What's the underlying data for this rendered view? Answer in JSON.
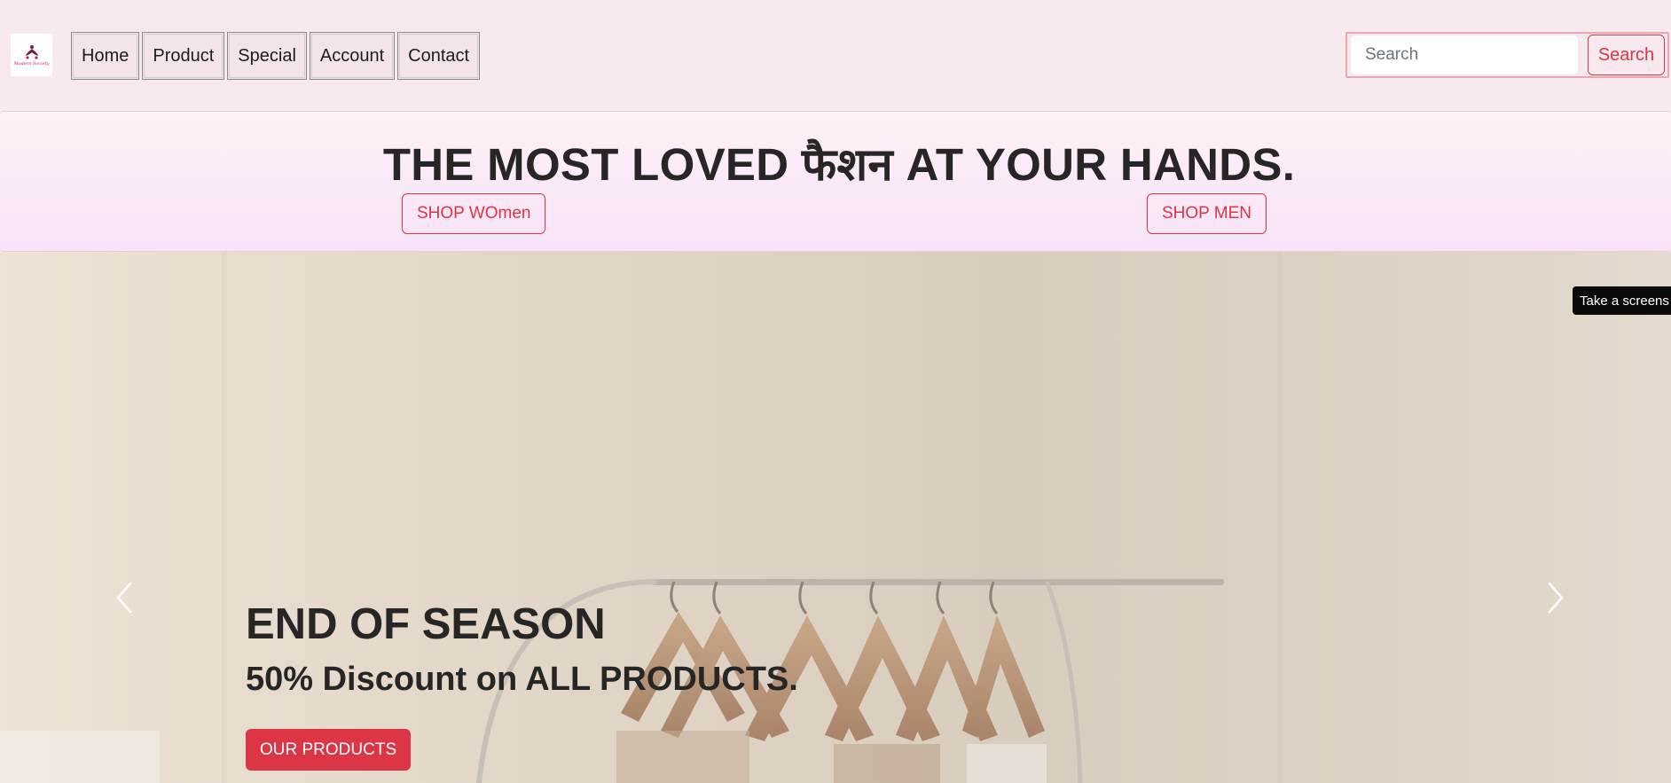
{
  "navbar": {
    "logo_text": "Modern Society",
    "links": [
      "Home",
      "Product",
      "Special",
      "Account",
      "Contact"
    ],
    "search": {
      "placeholder": "Search",
      "value": "",
      "button_label": "Search"
    }
  },
  "banner": {
    "headline": "THE MOST LOVED फैशन AT YOUR HANDS.",
    "shop_women_label": "SHOP WOmen",
    "shop_men_label": "SHOP MEN"
  },
  "hero": {
    "title": "END OF SEASON",
    "subtitle": "50% Discount on ALL PRODUCTS.",
    "cta_label": "OUR PRODUCTS"
  },
  "tooltip": {
    "text": "Take a screens"
  },
  "colors": {
    "accent": "#dc3545",
    "navbar_bg": "#f7e9ee",
    "banner_bg": "#f8e3f8"
  },
  "icons": {
    "prev": "chevron-left-icon",
    "next": "chevron-right-icon"
  }
}
